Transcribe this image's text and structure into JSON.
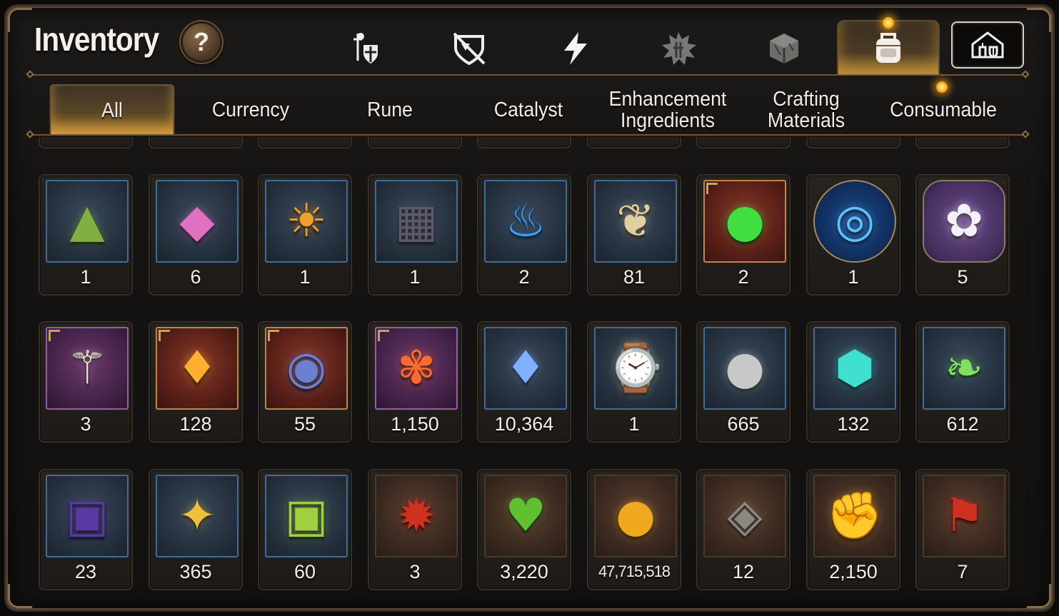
{
  "header": {
    "title": "Inventory",
    "help_label": "?"
  },
  "category_tabs": [
    {
      "icon": "knight-shield-icon",
      "active": false
    },
    {
      "icon": "broken-shield-icon",
      "active": false
    },
    {
      "icon": "lightning-icon",
      "active": false
    },
    {
      "icon": "splash-emblem-icon",
      "active": false
    },
    {
      "icon": "cube-icon",
      "active": false
    },
    {
      "icon": "backpack-icon",
      "active": true,
      "notification": true
    }
  ],
  "special_button": {
    "icon": "guild-house-icon"
  },
  "sub_tabs": [
    {
      "label": "All",
      "active": true
    },
    {
      "label": "Currency"
    },
    {
      "label": "Rune"
    },
    {
      "label": "Catalyst"
    },
    {
      "label": "Enhancement Ingredients"
    },
    {
      "label": "Crafting Materials"
    },
    {
      "label": "Consumable",
      "notification": true
    }
  ],
  "colors": {
    "accent_gold": "#c8a060",
    "tab_glow": "#ffbe46",
    "blue_frame": "#3f6c98",
    "rare_frame": "#b98a46",
    "epic_frame": "#9a5ab0"
  },
  "rows": [
    [
      {
        "icon": "green-powder-icon",
        "qty": "1",
        "bg": "blue"
      },
      {
        "icon": "pink-crystal-icon",
        "qty": "6",
        "bg": "blue"
      },
      {
        "icon": "sun-medallion-icon",
        "qty": "1",
        "bg": "blue"
      },
      {
        "icon": "ore-grid-icon",
        "qty": "1",
        "bg": "blue"
      },
      {
        "icon": "blue-flame-icon",
        "qty": "2",
        "bg": "blue"
      },
      {
        "icon": "ginseng-root-icon",
        "qty": "81",
        "bg": "blue"
      },
      {
        "icon": "green-orb-icon",
        "qty": "2",
        "bg": "red"
      },
      {
        "icon": "rune-circle-icon",
        "qty": "1",
        "bg": "round"
      },
      {
        "icon": "pet-food-icon",
        "qty": "5",
        "bg": "hex"
      }
    ],
    [
      {
        "icon": "feather-wand-icon",
        "qty": "3",
        "bg": "purple"
      },
      {
        "icon": "amber-crystal-icon",
        "qty": "128",
        "bg": "red"
      },
      {
        "icon": "star-ring-icon",
        "qty": "55",
        "bg": "red"
      },
      {
        "icon": "flower-ring-icon",
        "qty": "1,150",
        "bg": "purple"
      },
      {
        "icon": "blue-gem-icon",
        "qty": "10,364",
        "bg": "blue"
      },
      {
        "icon": "pocket-watch-icon",
        "qty": "1",
        "bg": "blue"
      },
      {
        "icon": "silver-coin-icon",
        "qty": "665",
        "bg": "blue"
      },
      {
        "icon": "teal-crystal-icon",
        "qty": "132",
        "bg": "blue"
      },
      {
        "icon": "green-leaf-icon",
        "qty": "612",
        "bg": "blue"
      }
    ],
    [
      {
        "icon": "purple-card-icon",
        "qty": "23",
        "bg": "blue"
      },
      {
        "icon": "star-pendant-icon",
        "qty": "365",
        "bg": "blue"
      },
      {
        "icon": "lime-card-icon",
        "qty": "60",
        "bg": "blue"
      },
      {
        "icon": "red-badge-icon",
        "qty": "3",
        "bg": "brown"
      },
      {
        "icon": "green-heart-icon",
        "qty": "3,220",
        "bg": "brown"
      },
      {
        "icon": "gold-coin-icon",
        "qty": "47,715,518",
        "bg": "brown",
        "small": true
      },
      {
        "icon": "compass-stone-icon",
        "qty": "12",
        "bg": "brown"
      },
      {
        "icon": "fist-emblem-icon",
        "qty": "2,150",
        "bg": "brown"
      },
      {
        "icon": "war-banner-icon",
        "qty": "7",
        "bg": "brown"
      }
    ]
  ]
}
